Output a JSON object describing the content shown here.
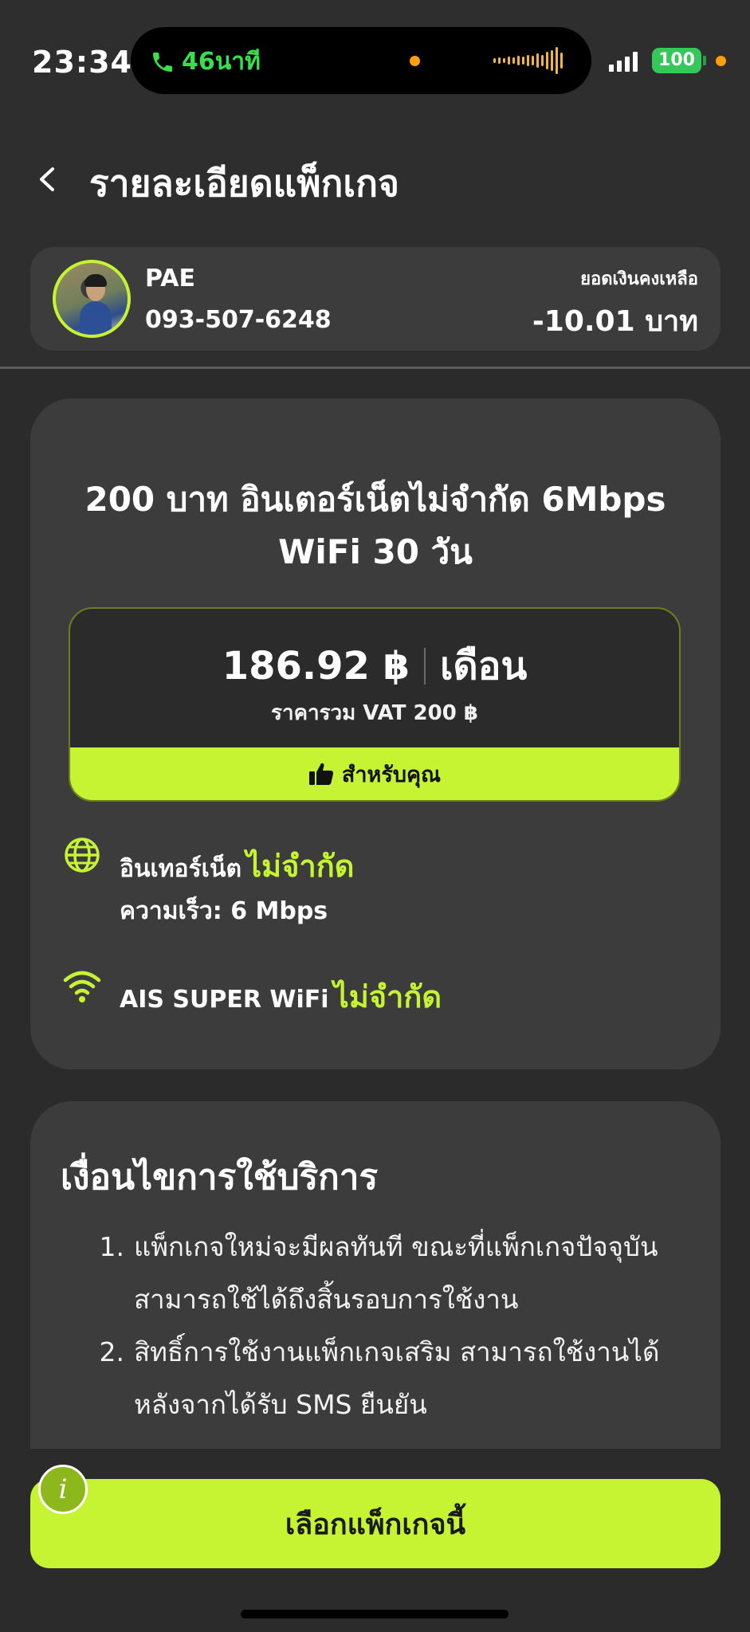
{
  "status_bar": {
    "time": "23:34",
    "call_duration": "46นาที",
    "battery": "100"
  },
  "header": {
    "title": "รายละเอียดแพ็กเกจ"
  },
  "account": {
    "name": "PAE",
    "phone": "093-507-6248",
    "balance_label": "ยอดเงินคงเหลือ",
    "balance_value": "-10.01 บาท"
  },
  "package": {
    "title_line1": "200 บาท อินเตอร์เน็ตไม่จำกัด 6Mbps",
    "title_line2": "WiFi 30 วัน",
    "price": "186.92 ฿",
    "period": "เดือน",
    "price_incl_vat": "ราคารวม VAT 200 ฿",
    "recommended_label": "สำหรับคุณ",
    "features": [
      {
        "icon": "globe-icon",
        "label": "อินเทอร์เน็ต",
        "highlight": "ไม่จำกัด",
        "sub": "ความเร็ว: 6 Mbps"
      },
      {
        "icon": "wifi-icon",
        "label": "AIS SUPER WiFi",
        "highlight": "ไม่จำกัด"
      }
    ]
  },
  "terms": {
    "title": "เงื่อนไขการใช้บริการ",
    "items": [
      {
        "num": "1.",
        "line1": "แพ็กเกจใหม่จะมีผลทันที ขณะที่แพ็กเกจปัจจุบัน",
        "line2": "สามารถใช้ได้ถึงสิ้นรอบการใช้งาน"
      },
      {
        "num": "2.",
        "line1": "สิทธิ์การใช้งานแพ็กเกจเสริม สามารถใช้งานได้",
        "line2": "หลังจากได้รับ SMS ยืนยัน"
      }
    ]
  },
  "bottom": {
    "select_button": "เลือกแพ็กเกจนี้",
    "info_button": "i"
  },
  "colors": {
    "accent": "#c6f432",
    "background": "#2b2b2b",
    "card": "#3c3c3c",
    "call_green": "#34e24b",
    "battery_green": "#34c759",
    "orange": "#ff9f0a"
  }
}
